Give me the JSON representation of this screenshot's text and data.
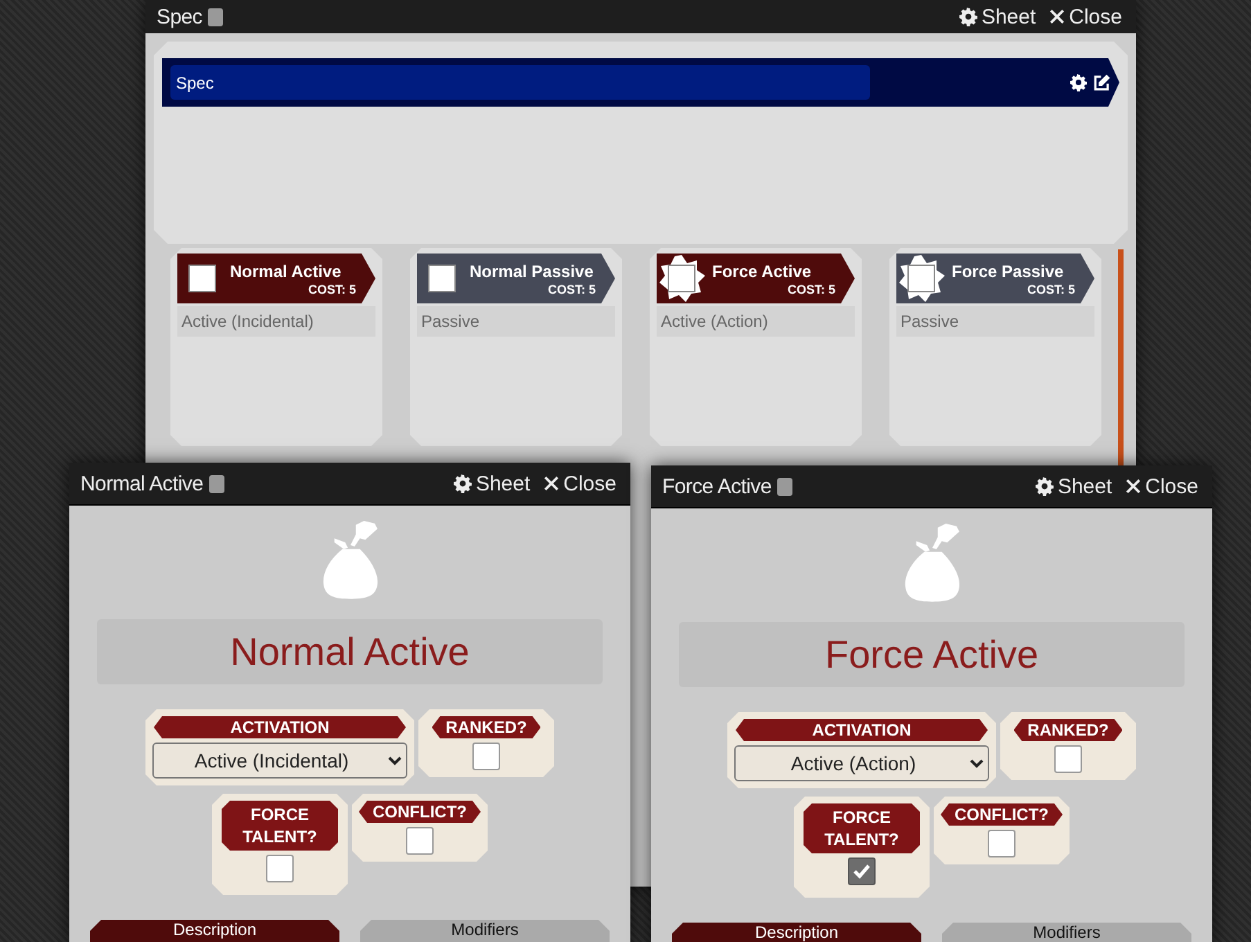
{
  "main_window": {
    "title": "Spec",
    "actions": [
      {
        "kind": "sheet",
        "label": "Sheet"
      },
      {
        "kind": "close",
        "label": "Close"
      }
    ],
    "spec_header": {
      "name": "Spec"
    },
    "talents": [
      {
        "name": "Normal Active",
        "cost": "COST: 5",
        "activation": "Active (Incidental)",
        "kind": "active",
        "force": false,
        "checked": false
      },
      {
        "name": "Normal Passive",
        "cost": "COST: 5",
        "activation": "Passive",
        "kind": "passive",
        "force": false,
        "checked": false
      },
      {
        "name": "Force Active",
        "cost": "COST: 5",
        "activation": "Active (Action)",
        "kind": "active",
        "force": true,
        "checked": false
      },
      {
        "name": "Force Passive",
        "cost": "COST: 5",
        "activation": "Passive",
        "kind": "passive",
        "force": true,
        "checked": false
      }
    ]
  },
  "dialogs": [
    {
      "title": "Normal Active",
      "actions": [
        {
          "kind": "sheet",
          "label": "Sheet"
        },
        {
          "kind": "close",
          "label": "Close"
        }
      ],
      "name": "Normal Active",
      "activation_label": "ACTIVATION",
      "activation": "Active (Incidental)",
      "checks": [
        {
          "label": "RANKED?",
          "checked": false
        },
        {
          "label": "FORCE TALENT?",
          "checked": false
        },
        {
          "label": "CONFLICT?",
          "checked": false
        }
      ],
      "tabs": [
        {
          "label": "Description",
          "selected": true
        },
        {
          "label": "Modifiers",
          "selected": false
        }
      ]
    },
    {
      "title": "Force Active",
      "actions": [
        {
          "kind": "sheet",
          "label": "Sheet"
        },
        {
          "kind": "close",
          "label": "Close"
        }
      ],
      "name": "Force Active",
      "activation_label": "ACTIVATION",
      "activation": "Active (Action)",
      "checks": [
        {
          "label": "RANKED?",
          "checked": false
        },
        {
          "label": "FORCE TALENT?",
          "checked": true
        },
        {
          "label": "CONFLICT?",
          "checked": false
        }
      ],
      "tabs": [
        {
          "label": "Description",
          "selected": true
        },
        {
          "label": "Modifiers",
          "selected": false
        }
      ]
    }
  ]
}
